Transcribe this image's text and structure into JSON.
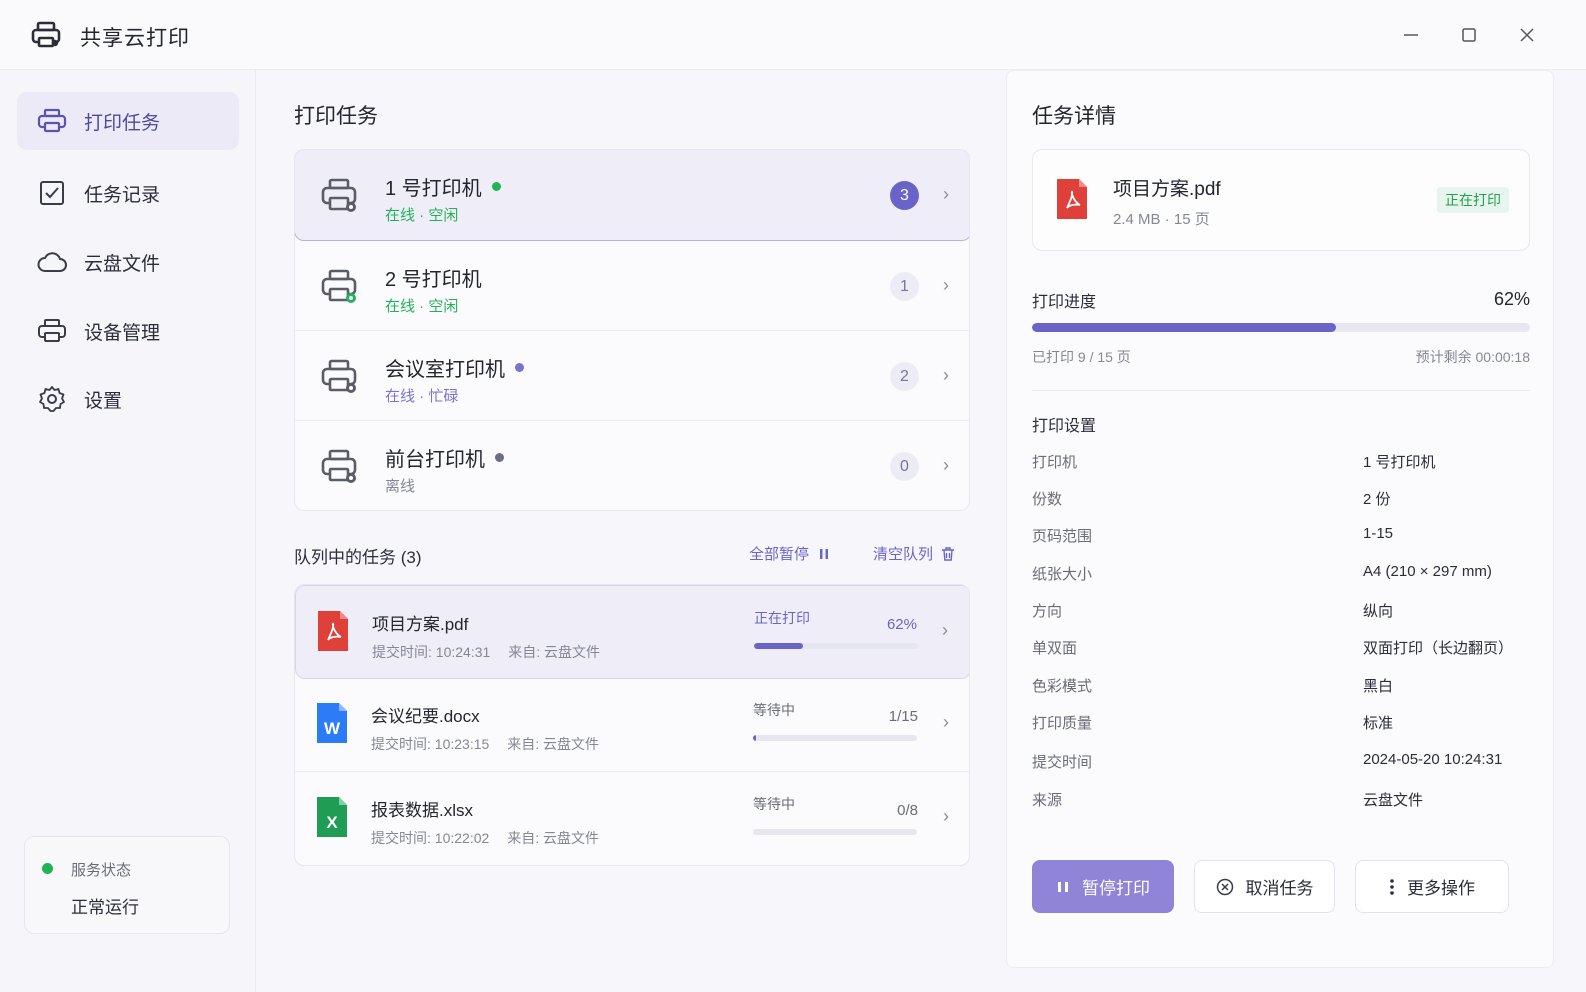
{
  "app": {
    "title": "共享云打印"
  },
  "sidebar": {
    "items": [
      {
        "label": "打印任务",
        "icon": "printer-icon"
      },
      {
        "label": "任务记录",
        "icon": "checkbox-icon"
      },
      {
        "label": "云盘文件",
        "icon": "cloud-icon"
      },
      {
        "label": "设备管理",
        "icon": "printer-icon"
      },
      {
        "label": "设置",
        "icon": "gear-icon"
      }
    ],
    "service": {
      "label": "服务状态",
      "value": "正常运行"
    }
  },
  "main": {
    "title": "打印任务",
    "printers": [
      {
        "name": "1 号打印机",
        "status": "在线 · 空闲",
        "count": "3",
        "status_color": "#22b35a",
        "dot_color": "#22b35a"
      },
      {
        "name": "2 号打印机",
        "status": "在线 · 空闲",
        "count": "1",
        "status_color": "#22b35a",
        "dot_color": ""
      },
      {
        "name": "会议室打印机",
        "status": "在线 · 忙碌",
        "count": "2",
        "status_color": "#7a74d0",
        "dot_color": "#7a74d0"
      },
      {
        "name": "前台打印机",
        "status": "离线",
        "count": "0",
        "status_color": "#858796",
        "dot_color": "#6b6f85"
      }
    ],
    "queue": {
      "title": "队列中的任务 (3)",
      "pause_all": "全部暂停",
      "clear": "清空队列",
      "items": [
        {
          "name": "项目方案.pdf",
          "time": "提交时间: 10:24:31",
          "source": "来自: 云盘文件",
          "status": "正在打印",
          "progress_text": "62%",
          "progress": 0.3,
          "type": "pdf"
        },
        {
          "name": "会议纪要.docx",
          "time": "提交时间: 10:23:15",
          "source": "来自: 云盘文件",
          "status": "等待中",
          "progress_text": "1/15",
          "progress": 0.02,
          "type": "docx"
        },
        {
          "name": "报表数据.xlsx",
          "time": "提交时间: 10:22:02",
          "source": "来自: 云盘文件",
          "status": "等待中",
          "progress_text": "0/8",
          "progress": 0.0,
          "type": "xlsx"
        }
      ]
    }
  },
  "detail": {
    "title": "任务详情",
    "file": {
      "name": "项目方案.pdf",
      "meta": "2.4 MB · 15 页",
      "badge": "正在打印"
    },
    "progress": {
      "label": "打印进度",
      "pct_text": "62%",
      "value": 0.61,
      "printed": "已打印 9 / 15 页",
      "remaining": "预计剩余 00:00:18"
    },
    "settings_title": "打印设置",
    "settings": [
      {
        "k": "打印机",
        "v": "1 号打印机"
      },
      {
        "k": "份数",
        "v": "2 份"
      },
      {
        "k": "页码范围",
        "v": "1-15"
      },
      {
        "k": "纸张大小",
        "v": "A4 (210 × 297 mm)"
      },
      {
        "k": "方向",
        "v": "纵向"
      },
      {
        "k": "单双面",
        "v": "双面打印（长边翻页）"
      },
      {
        "k": "色彩模式",
        "v": "黑白"
      },
      {
        "k": "打印质量",
        "v": "标准"
      },
      {
        "k": "提交时间",
        "v": "2024-05-20 10:24:31"
      },
      {
        "k": "来源",
        "v": "云盘文件"
      }
    ],
    "buttons": {
      "pause": "暂停打印",
      "cancel": "取消任务",
      "more": "更多操作"
    }
  },
  "colors": {
    "accent": "#6b64c8",
    "success": "#22b35a",
    "pdf": "#e0403a",
    "word": "#2b7cf6",
    "excel": "#1f9d55"
  }
}
